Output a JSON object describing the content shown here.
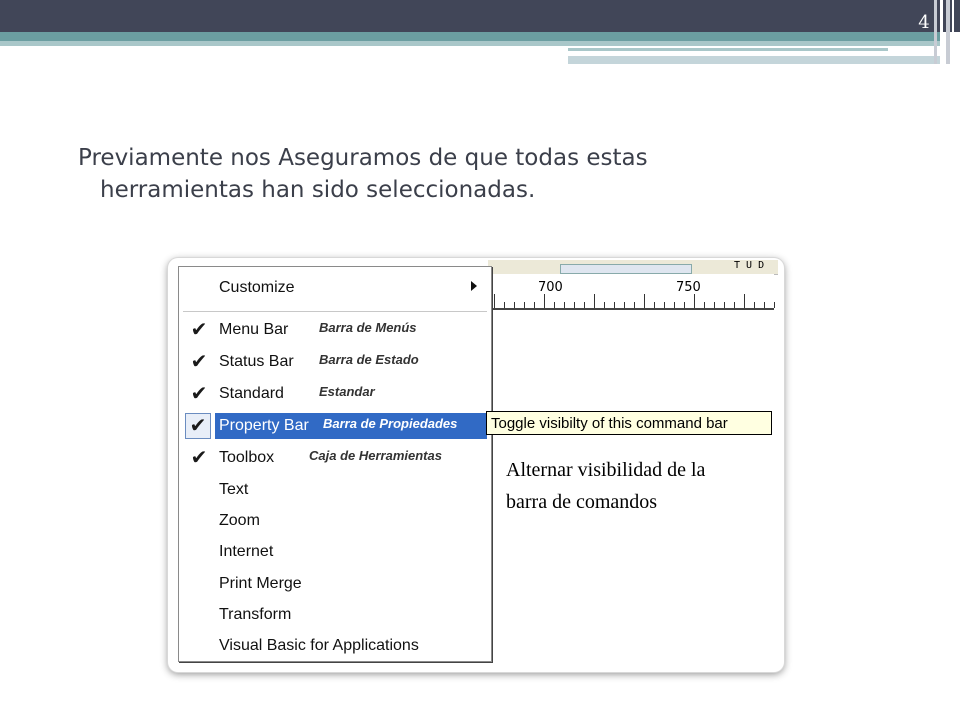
{
  "slide": {
    "page_number": "4",
    "bullet_line1": "Previamente nos Aseguramos de que todas estas",
    "bullet_line2": "herramientas han sido seleccionadas."
  },
  "screenshot": {
    "ruler_labels": [
      "700",
      "750"
    ],
    "toolbar_label": "T U D",
    "menu": {
      "header_item": "Customize",
      "items": [
        {
          "label": "Menu Bar",
          "translation": "Barra de Menús",
          "checked": true,
          "selected": false
        },
        {
          "label": "Status Bar",
          "translation": "Barra de Estado",
          "checked": true,
          "selected": false
        },
        {
          "label": "Standard",
          "translation": "Estandar",
          "checked": true,
          "selected": false
        },
        {
          "label": "Property Bar",
          "translation": "Barra de Propiedades",
          "checked": true,
          "selected": true
        },
        {
          "label": "Toolbox",
          "translation": "Caja de Herramientas",
          "checked": true,
          "selected": false
        },
        {
          "label": "Text",
          "translation": "",
          "checked": false,
          "selected": false
        },
        {
          "label": "Zoom",
          "translation": "",
          "checked": false,
          "selected": false
        },
        {
          "label": "Internet",
          "translation": "",
          "checked": false,
          "selected": false
        },
        {
          "label": "Print Merge",
          "translation": "",
          "checked": false,
          "selected": false
        },
        {
          "label": "Transform",
          "translation": "",
          "checked": false,
          "selected": false
        },
        {
          "label": "Visual Basic for Applications",
          "translation": "",
          "checked": false,
          "selected": false
        }
      ]
    },
    "tooltip": "Toggle visibilty of this command bar",
    "note_line1": "Alternar visibilidad de la",
    "note_line2": "barra de comandos"
  },
  "colors": {
    "topbar": "#414658",
    "accent_band": "#6b9ea1",
    "selection": "#316ac5",
    "tooltip_bg": "#ffffe1"
  }
}
